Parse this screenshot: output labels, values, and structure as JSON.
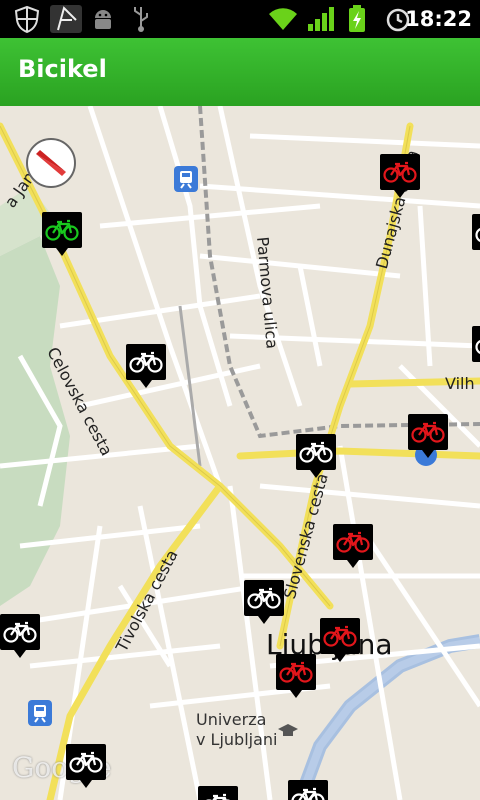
{
  "status_bar": {
    "time": "18:22",
    "icons": [
      "shield-icon",
      "music-icon",
      "android-icon",
      "usb-icon",
      "wifi-icon",
      "signal-icon",
      "battery-charging-icon",
      "alarm-icon"
    ]
  },
  "app": {
    "title": "Bicikel",
    "accent": "#35b52b"
  },
  "map": {
    "streets": {
      "celovska": "Celovska cesta",
      "tivolska": "Tivolska cesta",
      "slovenska": "Slovenska cesta",
      "dunajska": "Dunajska cesta",
      "parmova": "Parmova ulica",
      "vilh": "Vilh",
      "jami": "a Jami"
    },
    "city": "Ljubljana",
    "university": {
      "line1": "Univerza",
      "line2": "v Ljubljani"
    },
    "attribution": "Google",
    "marker_colors": {
      "green": "#19c81e",
      "red": "#e2161b",
      "white": "#ffffff"
    }
  }
}
